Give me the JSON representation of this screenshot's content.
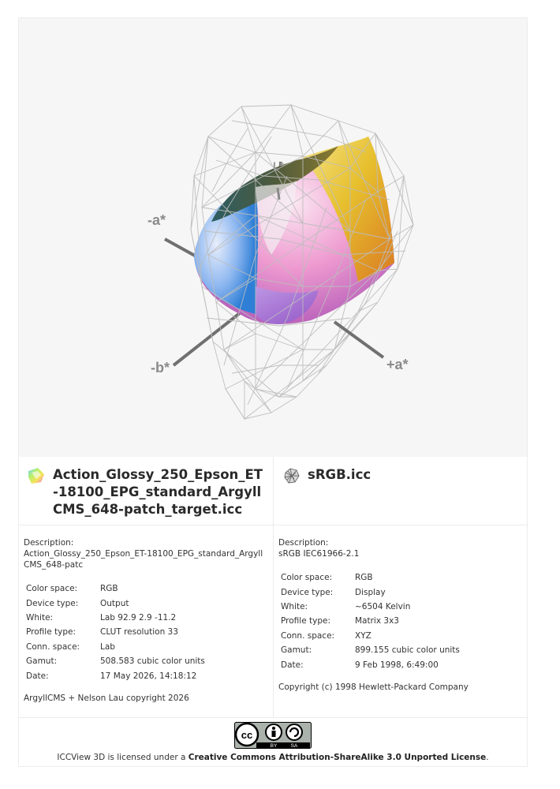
{
  "viewer": {
    "axis_labels": {
      "neg_a": "-a*",
      "pos_a": "+a*",
      "neg_b": "-b*",
      "l": "L*"
    }
  },
  "profiles": [
    {
      "name": "Action_Glossy_250_Epson_ET-18100_EPG_standard_ArgyllCMS_648-patch_target.icc",
      "icon": "color-profile-icon",
      "description_label": "Description:",
      "description": "Action_Glossy_250_Epson_ET-18100_EPG_standard_ArgyllCMS_648-patc",
      "properties": [
        {
          "key": "Color space:",
          "value": "RGB"
        },
        {
          "key": "Device type:",
          "value": "Output"
        },
        {
          "key": "White:",
          "value": "Lab 92.9 2.9 -11.2"
        },
        {
          "key": "Profile type:",
          "value": "CLUT resolution 33"
        },
        {
          "key": "Conn. space:",
          "value": "Lab"
        },
        {
          "key": "Gamut:",
          "value": "508.583 cubic color units"
        },
        {
          "key": "Date:",
          "value": "17 May 2026, 14:18:12"
        }
      ],
      "copyright": "ArgyllCMS + Nelson Lau copyright 2026"
    },
    {
      "name": "sRGB.icc",
      "icon": "wireframe-profile-icon",
      "description_label": "Description:",
      "description": "sRGB IEC61966-2.1",
      "properties": [
        {
          "key": "Color space:",
          "value": "RGB"
        },
        {
          "key": "Device type:",
          "value": "Display"
        },
        {
          "key": "White:",
          "value": "~6504 Kelvin"
        },
        {
          "key": "Profile type:",
          "value": "Matrix 3x3"
        },
        {
          "key": "Conn. space:",
          "value": "XYZ"
        },
        {
          "key": "Gamut:",
          "value": "899.155 cubic color units"
        },
        {
          "key": "Date:",
          "value": "9 Feb 1998, 6:49:00"
        }
      ],
      "copyright": "Copyright (c) 1998 Hewlett-Packard Company"
    }
  ],
  "footer": {
    "badge_icon": "cc-by-sa-badge-icon",
    "badge_by": "BY",
    "badge_sa": "SA",
    "license_prefix": "ICCView 3D is licensed under a ",
    "license_link": "Creative Commons Attribution-ShareAlike 3.0 Unported License",
    "license_suffix": "."
  }
}
